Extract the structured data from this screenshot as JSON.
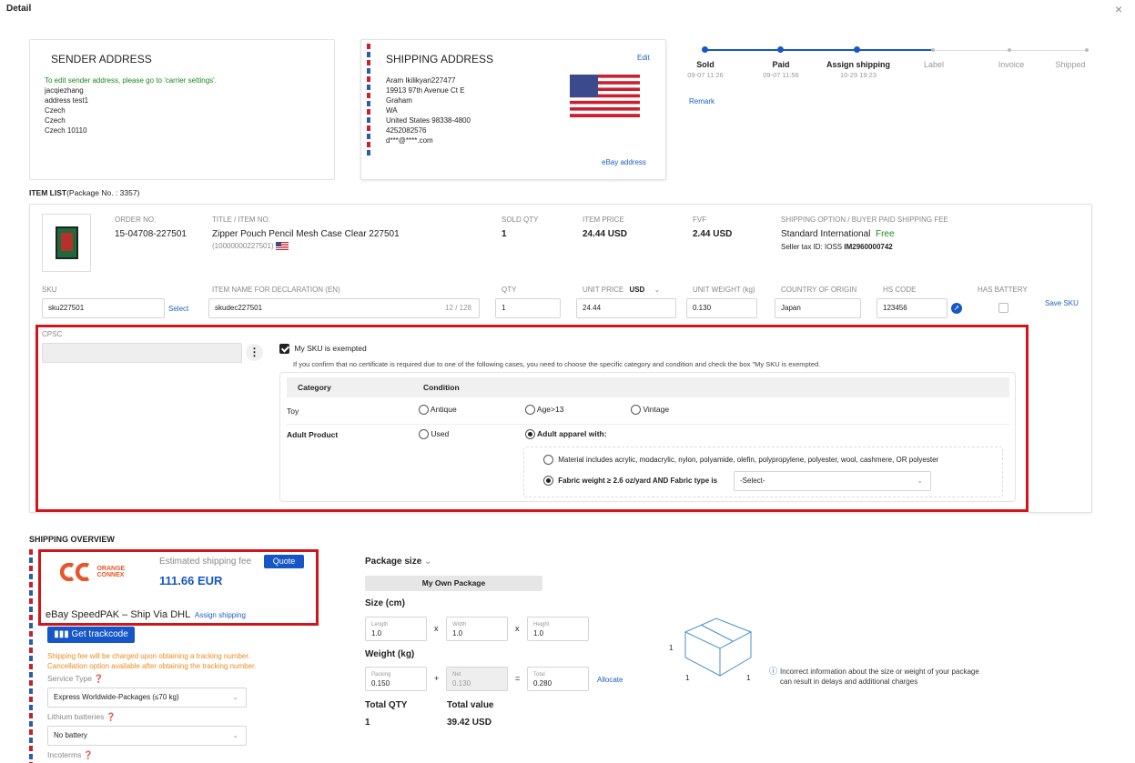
{
  "header": {
    "title": "Detail",
    "close": "×"
  },
  "sender": {
    "title": "SENDER ADDRESS",
    "note": "To edit sender address, please go to 'carrier settings'.",
    "lines": [
      "jacqiezhang",
      "address test1",
      "Czech",
      "Czech",
      "Czech 10110"
    ]
  },
  "shipping_address": {
    "title": "SHIPPING ADDRESS",
    "edit": "Edit",
    "lines": [
      "Aram Ikilikyan227477",
      "19913 97th Avenue Ct E",
      "Graham",
      "WA",
      "United States 98338-4800",
      "4252082576",
      "d***@****.com"
    ],
    "ebay_address": "eBay address"
  },
  "progress": {
    "steps": [
      {
        "label": "Sold",
        "time": "09-07 11:26",
        "done": true
      },
      {
        "label": "Paid",
        "time": "09-07 11:56",
        "done": true
      },
      {
        "label": "Assign shipping",
        "time": "10-29 19:23",
        "done": true
      },
      {
        "label": "Label",
        "time": "",
        "done": false
      },
      {
        "label": "Invoice",
        "time": "",
        "done": false
      },
      {
        "label": "Shipped",
        "time": "",
        "done": false
      }
    ],
    "remark": "Remark"
  },
  "item_list": {
    "title": "ITEM LIST",
    "package": "(Package No. : 3357)",
    "headers": {
      "order_no": "ORDER NO.",
      "title": "TITLE / ITEM NO.",
      "sold_qty": "SOLD QTY",
      "item_price": "ITEM PRICE",
      "fvf": "FVF",
      "shipping_option": "SHIPPING OPTION / BUYER PAID SHIPPING FEE"
    },
    "row": {
      "order_no": "15-04708-227501",
      "title": "Zipper Pouch Pencil Mesh Case Clear 227501",
      "item_no": "(10000000227501)",
      "sold_qty": "1",
      "item_price": "24.44 USD",
      "fvf": "2.44 USD",
      "shipping_option": "Standard International",
      "shipping_fee": "Free",
      "seller_tax_prefix": "Seller tax ID: IOSS",
      "seller_tax_id": "IM2960000742"
    },
    "decl_headers": {
      "sku": "SKU",
      "item_name": "ITEM NAME FOR DECLARATION (EN)",
      "qty": "QTY",
      "unit_price": "UNIT PRICE",
      "currency": "USD",
      "unit_weight": "UNIT WEIGHT (kg)",
      "country": "COUNTRY OF ORIGIN",
      "hs_code": "HS CODE",
      "battery": "HAS BATTERY"
    },
    "decl": {
      "sku": "sku227501",
      "select": "Select",
      "item_name": "skudec227501",
      "item_name_count": "12 / 128",
      "qty": "1",
      "unit_price": "24.44",
      "unit_weight": "0.130",
      "country": "Japan",
      "hs_code": "123456",
      "save_sku": "Save SKU"
    }
  },
  "cpsc": {
    "label": "CPSC",
    "exempt_label": "My SKU is exempted",
    "exempt_note": "If you confirm that no certificate is required due to one of the following cases, you need to choose the specific category and condition and check the box \"My SKU is exempted.",
    "table_headers": {
      "category": "Category",
      "condition": "Condition"
    },
    "toy": {
      "label": "Toy",
      "options": [
        "Antique",
        "Age>13",
        "Vintage"
      ]
    },
    "adult": {
      "label": "Adult Product",
      "used": "Used",
      "apparel": "Adult apparel with:",
      "material": "Material includes acrylic, modacrylic, nylon, polyamide, olefin, polypropylene, polyester, wool, cashmere, OR polyester",
      "fabric": "Fabric weight ≥ 2.6 oz/yard AND Fabric type is",
      "select": "-Select-"
    }
  },
  "shipping_overview": {
    "title": "SHIPPING OVERVIEW",
    "logo_line1": "ORANGE",
    "logo_line2": "CONNEX",
    "est_label": "Estimated shipping fee",
    "quote": "Quote",
    "fee": "111.66 EUR",
    "service": "eBay SpeedPAK – Ship Via DHL",
    "assign": "Assign shipping",
    "get_trackcode": "Get trackcode",
    "warn1": "Shipping fee will be charged upon obtaining a tracking number.",
    "warn2": "Cancellation option available after obtaining the tracking number.",
    "service_type_label": "Service Type",
    "service_type": "Express Worldwide-Packages (≤70 kg)",
    "lithium_label": "Lithium batteries",
    "lithium": "No battery",
    "incoterms_label": "Incoterms"
  },
  "package": {
    "size_label": "Package size",
    "own_package": "My Own Package",
    "size_title": "Size (cm)",
    "length_label": "Length",
    "length": "1.0",
    "width_label": "Width",
    "width": "1.0",
    "height_label": "Height",
    "height": "1.0",
    "x": "x",
    "weight_title": "Weight (kg)",
    "packing_label": "Packing",
    "packing": "0.150",
    "plus": "+",
    "net_label": "Net",
    "net": "0.130",
    "eq": "=",
    "total_label": "Total",
    "total": "0.280",
    "allocate": "Allocate",
    "total_qty_label": "Total QTY",
    "total_qty": "1",
    "total_value_label": "Total value",
    "total_value": "39.42 USD",
    "box_dims": [
      "1",
      "1",
      "1"
    ],
    "warning": "Incorrect information about the size or weight of your package can result in delays and additional charges"
  }
}
